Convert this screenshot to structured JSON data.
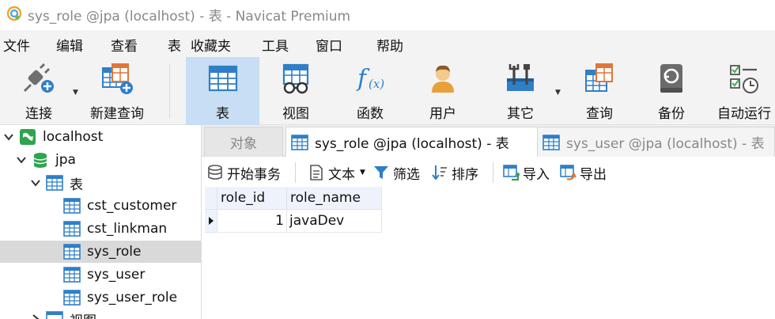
{
  "window": {
    "title": "sys_role @jpa (localhost) - 表 - Navicat Premium",
    "app_icon": "navicat-logo-icon"
  },
  "menu": {
    "items": [
      {
        "label": "文件"
      },
      {
        "label": "编辑"
      },
      {
        "label": "查看"
      },
      {
        "label": "表"
      },
      {
        "label": "收藏夹"
      },
      {
        "label": "工具"
      },
      {
        "label": "窗口"
      },
      {
        "label": "帮助"
      }
    ]
  },
  "toolbar": {
    "items": [
      {
        "label": "连接",
        "icon": "plug-connect-icon",
        "has_dropdown": true
      },
      {
        "label": "新建查询",
        "icon": "new-query-icon",
        "has_dropdown": false
      },
      {
        "label": "表",
        "icon": "table-icon",
        "active": true
      },
      {
        "label": "视图",
        "icon": "view-glasses-icon"
      },
      {
        "label": "函数",
        "icon": "function-fx-icon"
      },
      {
        "label": "用户",
        "icon": "user-icon"
      },
      {
        "label": "其它",
        "icon": "tools-icon",
        "has_dropdown": true
      },
      {
        "label": "查询",
        "icon": "query-icon"
      },
      {
        "label": "备份",
        "icon": "backup-icon"
      },
      {
        "label": "自动运行",
        "icon": "auto-run-icon"
      }
    ]
  },
  "navigator": {
    "nodes": [
      {
        "label": "localhost",
        "icon": "connection-icon",
        "expanded": true
      },
      {
        "label": "jpa",
        "icon": "database-icon",
        "expanded": true
      },
      {
        "label": "表",
        "icon": "tables-folder-icon",
        "expanded": true
      },
      {
        "label": "cst_customer",
        "icon": "table-icon"
      },
      {
        "label": "cst_linkman",
        "icon": "table-icon"
      },
      {
        "label": "sys_role",
        "icon": "table-icon",
        "selected": true
      },
      {
        "label": "sys_user",
        "icon": "table-icon"
      },
      {
        "label": "sys_user_role",
        "icon": "table-icon"
      },
      {
        "label": "视图",
        "icon": "views-folder-icon"
      }
    ]
  },
  "tabs": {
    "objects": "对象",
    "active": "sys_role @jpa (localhost) - 表",
    "inactive": "sys_user @jpa (localhost) - 表"
  },
  "subtoolbar": {
    "begin_transaction": "开始事务",
    "text": "文本",
    "filter": "筛选",
    "sort": "排序",
    "import": "导入",
    "export": "导出"
  },
  "grid": {
    "columns": [
      "role_id",
      "role_name"
    ],
    "rows": [
      {
        "role_id": "1",
        "role_name": "javaDev"
      }
    ]
  },
  "colors": {
    "toolbar_active": "#c7def4",
    "selected_node": "#d9d9d9",
    "header_bg": "#eef3fb",
    "table_icon_blue": "#2f7fc8"
  }
}
